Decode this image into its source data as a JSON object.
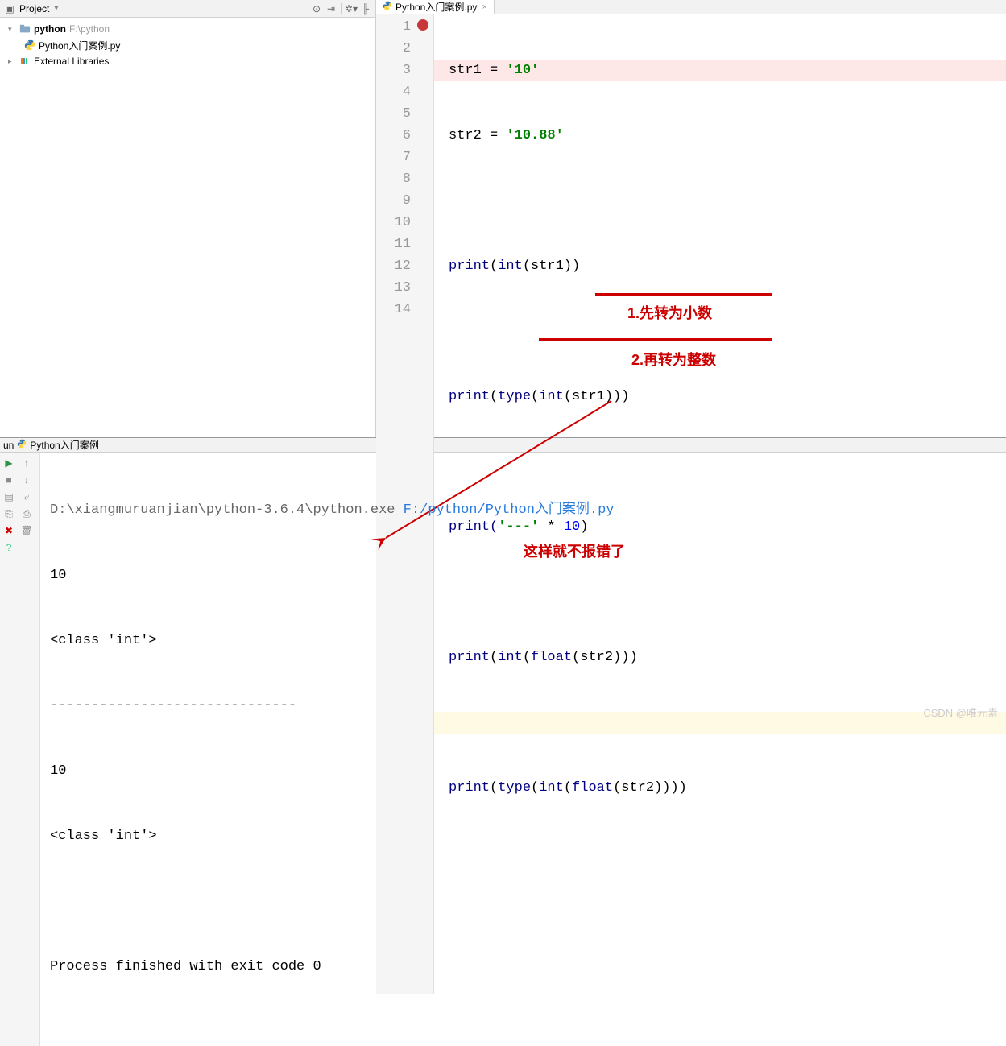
{
  "sidebar": {
    "title": "Project",
    "root": {
      "name": "python",
      "path": "F:\\python"
    },
    "file": "Python入门案例.py",
    "external": "External Libraries"
  },
  "tab": {
    "filename": "Python入门案例.py"
  },
  "gutter": {
    "start": 1,
    "end": 14
  },
  "code": {
    "l1": {
      "a": "str1 ",
      "b": "= ",
      "c": "'10'"
    },
    "l2": {
      "a": "str2 ",
      "b": "= ",
      "c": "'10.88'"
    },
    "l4": "print(int(str1))",
    "l6": "print(type(int(str1)))",
    "l8_a": "print(",
    "l8_b": "'---'",
    "l8_c": " * ",
    "l8_d": "10",
    "l8_e": ")",
    "l10": "print(int(float(str2)))",
    "l12": "print(type(int(float(str2))))"
  },
  "annotations": {
    "a1": "1.先转为小数",
    "a2": "2.再转为整数",
    "a3": "这样就不报错了"
  },
  "run": {
    "label": "un",
    "name": "Python入门案例",
    "path_prefix": "D:\\xiangmuruanjian\\python-3.6.4\\python.exe ",
    "path_link": "F:/python/Python入门案例.py",
    "out1": "10",
    "out2": "<class 'int'>",
    "out3": "------------------------------",
    "out4": "10",
    "out5": "<class 'int'>",
    "exit": "Process finished with exit code 0"
  },
  "watermark": "CSDN @唯元素"
}
